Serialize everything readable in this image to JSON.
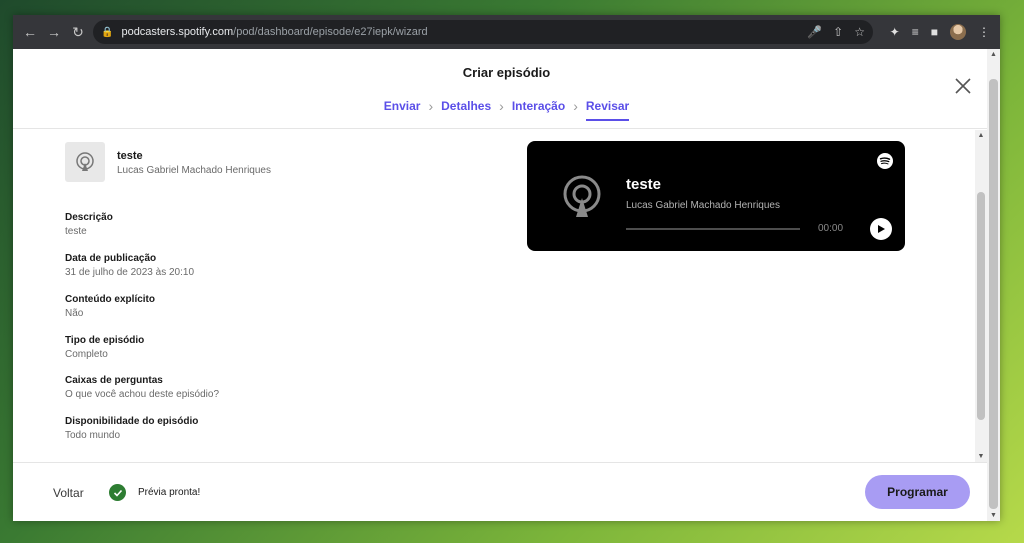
{
  "browser": {
    "url_host": "podcasters.spotify.com",
    "url_path": "/pod/dashboard/episode/e27iepk/wizard"
  },
  "modal": {
    "title": "Criar episódio",
    "steps": [
      {
        "label": "Enviar"
      },
      {
        "label": "Detalhes"
      },
      {
        "label": "Interação"
      },
      {
        "label": "Revisar"
      }
    ],
    "active_step": "Revisar"
  },
  "episode": {
    "name": "teste",
    "author": "Lucas Gabriel Machado Henriques"
  },
  "fields": [
    {
      "label": "Descrição",
      "value": "teste"
    },
    {
      "label": "Data de publicação",
      "value": "31 de julho de 2023 às 20:10"
    },
    {
      "label": "Conteúdo explícito",
      "value": "Não"
    },
    {
      "label": "Tipo de episódio",
      "value": "Completo"
    },
    {
      "label": "Caixas de perguntas",
      "value": "O que você achou deste episódio?"
    },
    {
      "label": "Disponibilidade do episódio",
      "value": "Todo mundo"
    }
  ],
  "player": {
    "title": "teste",
    "author": "Lucas Gabriel Machado Henriques",
    "time": "00:00"
  },
  "footer": {
    "back_label": "Voltar",
    "status_label": "Prévia pronta!",
    "schedule_label": "Programar"
  },
  "colors": {
    "accent": "#5b4fe8",
    "schedule_button": "#a89cf3",
    "success": "#2e7d32"
  }
}
